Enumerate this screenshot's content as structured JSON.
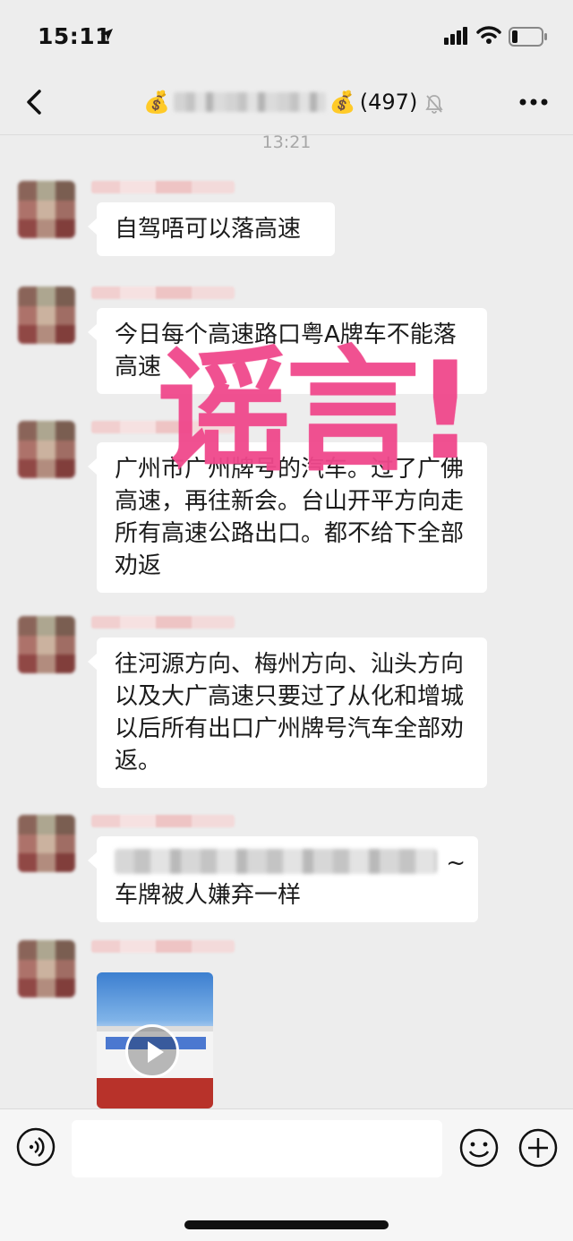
{
  "status_bar": {
    "time": "15:11"
  },
  "nav": {
    "title_prefix_icon": "💰",
    "title_suffix_icon": "💰",
    "member_count": "(497)"
  },
  "timestamp": "13:21",
  "messages": [
    {
      "text": "自驾唔可以落高速"
    },
    {
      "text": "今日每个高速路口粤A牌车不能落高速"
    },
    {
      "text": "广州市广州牌号的汽车。过了广佛高速，再往新会。台山开平方向走所有高速公路出口。都不给下全部劝返"
    },
    {
      "text": "往河源方向、梅州方向、汕头方向以及大广高速只要过了从化和增城以后所有出口广州牌号汽车全部劝返。"
    },
    {
      "tail": "~",
      "text": "车牌被人嫌弃一样"
    }
  ],
  "stamp_text": "谣言!",
  "colors": {
    "background": "#ededed",
    "stamp": "#f0488c",
    "bubble": "#ffffff"
  }
}
